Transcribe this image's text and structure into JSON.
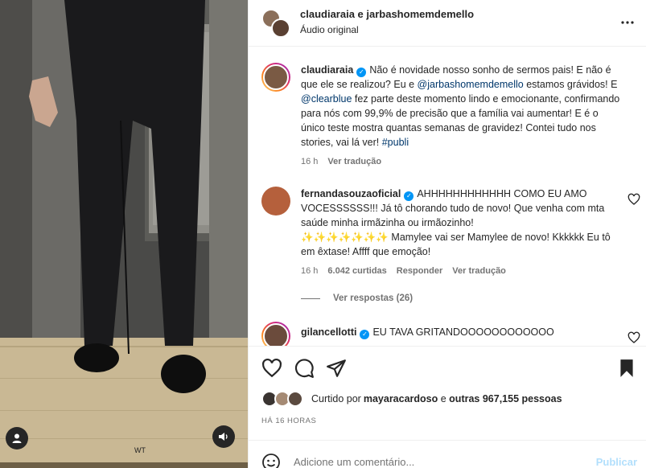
{
  "header": {
    "title": "claudiaraia e jarbashomemdemello",
    "audio_label": "Áudio original",
    "more_icon": "more-horizontal-icon"
  },
  "caption": {
    "username": "claudiaraia",
    "text_1": "Não é novidade nosso sonho de sermos pais! E não é que ele se realizou? Eu e ",
    "mention_1": "@jarbashomemdemello",
    "text_2": " estamos grávidos! E ",
    "mention_2": "@clearblue",
    "text_3": " fez parte deste momento lindo e emocionante, confirmando para nós com 99,9% de precisão que a família vai aumentar! E é o único teste mostra quantas semanas de gravidez! Contei tudo nos stories, vai lá ver! ",
    "hashtag": "#publi",
    "time": "16 h",
    "translate": "Ver tradução"
  },
  "comments": [
    {
      "username": "fernandasouzaoficial",
      "text": "AHHHHHHHHHHHH COMO EU AMO VOCESSSSSS!!! Já tô chorando tudo de novo! Que venha com mta saúde minha irmãzinha ou irmãozinho!",
      "text_2": "✨✨✨✨✨✨✨ Mamylee vai ser Mamylee de novo! Kkkkkk Eu tô em êxtase! Affff que emoção!",
      "time": "16 h",
      "likes": "6.042 curtidas",
      "reply": "Responder",
      "translate": "Ver tradução",
      "view_replies": "Ver respostas (26)"
    },
    {
      "username": "gilancellotti",
      "text": "EU TAVA GRITANDOOOOOOOOOOOO"
    }
  ],
  "liked_by": {
    "prefix": "Curtido por ",
    "user": "mayaracardoso",
    "middle": " e ",
    "others": "outras 967,155 pessoas"
  },
  "timestamp": "HÁ 16 HORAS",
  "add_comment": {
    "placeholder": "Adicione um comentário...",
    "post_label": "Publicar"
  },
  "colors": {
    "link": "#00376b",
    "verified": "#0095f6",
    "post_disabled": "#b2dffc"
  }
}
